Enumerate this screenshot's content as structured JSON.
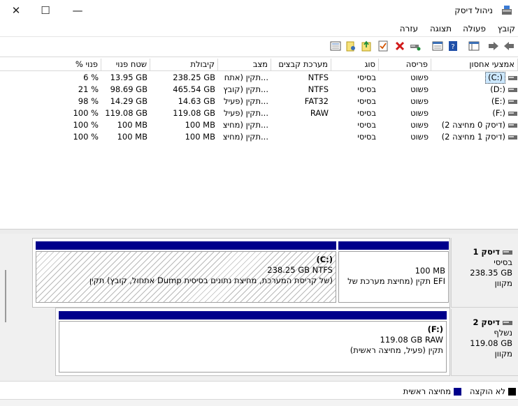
{
  "window": {
    "title": "ניהול דיסק",
    "close_glyph": "✕",
    "maximize_glyph": "☐",
    "minimize_glyph": "—"
  },
  "menu": [
    "קובץ",
    "פעולה",
    "תצוגה",
    "עזרה"
  ],
  "toolbar": {
    "icons": [
      "back-icon",
      "forward-icon",
      "show-hide-console-tree-icon",
      "help-icon",
      "properties-icon",
      "connect-drive-icon",
      "delete-icon",
      "checklist-icon",
      "new-folder-icon",
      "folder-icon",
      "list-icon"
    ]
  },
  "table": {
    "columns": [
      "אמצעי אחסון",
      "פריסה",
      "סוג",
      "מערכת קבצים",
      "מצב",
      "קיבולת",
      "שטח פנוי",
      "% פנוי"
    ],
    "rows": [
      {
        "volume": "(C:)",
        "layout": "פשוט",
        "type": "בסיסי",
        "fs": "NTFS",
        "status": "תקין (אתח...",
        "capacity": "238.25 GB",
        "free": "13.95 GB",
        "pct": "6 %",
        "selected": true
      },
      {
        "volume": "(D:)",
        "layout": "פשוט",
        "type": "בסיסי",
        "fs": "NTFS",
        "status": "תקין (קובץ...",
        "capacity": "465.54 GB",
        "free": "98.69 GB",
        "pct": "21 %",
        "selected": false
      },
      {
        "volume": "(E:)",
        "layout": "פשוט",
        "type": "בסיסי",
        "fs": "FAT32",
        "status": "תקין (פעיל...",
        "capacity": "14.63 GB",
        "free": "14.29 GB",
        "pct": "98 %",
        "selected": false
      },
      {
        "volume": "(F:)",
        "layout": "פשוט",
        "type": "בסיסי",
        "fs": "RAW",
        "status": "תקין (פעיל...",
        "capacity": "119.08 GB",
        "free": "119.08 GB",
        "pct": "100 %",
        "selected": false
      },
      {
        "volume": "(דיסק 0 מחיצה 2)",
        "layout": "פשוט",
        "type": "בסיסי",
        "fs": "",
        "status": "תקין (מחיצ...",
        "capacity": "100 MB",
        "free": "100 MB",
        "pct": "100 %",
        "selected": false
      },
      {
        "volume": "(דיסק 1 מחיצה 2)",
        "layout": "פשוט",
        "type": "בסיסי",
        "fs": "",
        "status": "תקין (מחיצ...",
        "capacity": "100 MB",
        "free": "100 MB",
        "pct": "100 %",
        "selected": false
      }
    ]
  },
  "disks": [
    {
      "name": "דיסק 1",
      "type": "בסיסי",
      "size": "238.35 GB",
      "state": "מקוון",
      "partitions": [
        {
          "title": "",
          "size": "100 MB",
          "desc": "תקין (מחיצת מערכת של EFI"
        },
        {
          "title": "(C:)",
          "size": "238.25 GB NTFS",
          "desc": "תקין (אתחול, קובץ Dump של קריסת המערכת, מחיצת נתונים בסיסית)"
        }
      ]
    },
    {
      "name": "דיסק 2",
      "type": "נשלף",
      "size": "119.08 GB",
      "state": "מקוון",
      "partitions": [
        {
          "title": "(F:)",
          "size": "119.08 GB RAW",
          "desc": "תקין (פעיל, מחיצה ראשית)"
        }
      ]
    }
  ],
  "legend": [
    {
      "label": "לא הוקצה",
      "color": "#000000"
    },
    {
      "label": "מחיצה ראשית",
      "color": "#00008b"
    }
  ]
}
